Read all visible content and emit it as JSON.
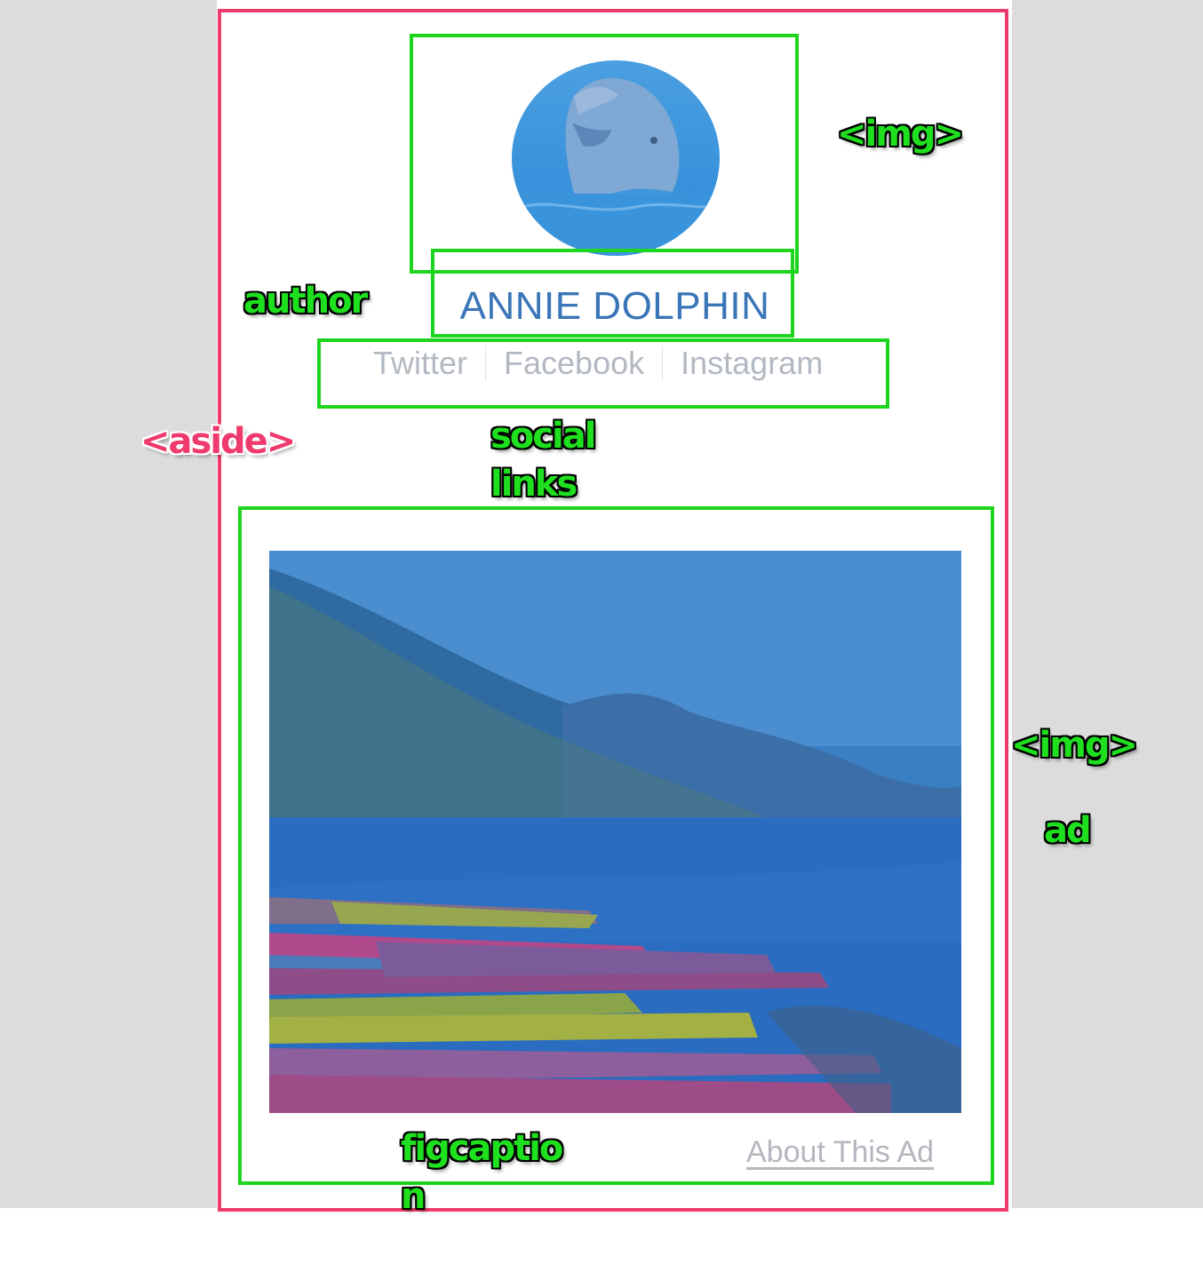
{
  "profile": {
    "author_name": "ANNIE DOLPHIN"
  },
  "social_links": [
    "Twitter",
    "Facebook",
    "Instagram"
  ],
  "ad": {
    "caption_link": "About This Ad"
  },
  "annotations": {
    "img_top": "<img>",
    "author": "author",
    "aside": "<aside>",
    "social_links_line1": "social",
    "social_links_line2": "links",
    "img_ad": "<img>",
    "ad": "ad",
    "figcaption_line1": "figcaptio",
    "figcaption_line2": "n"
  },
  "colors": {
    "aside_outline": "#ee3a6c",
    "element_outline": "#1ed51e",
    "author_text": "#3a75b8",
    "muted_link": "#b3b9c1",
    "page_background": "#dcdcdc"
  },
  "icons": {
    "avatar": "dolphin-photo",
    "ad_image": "kayaks-lake-photo"
  }
}
